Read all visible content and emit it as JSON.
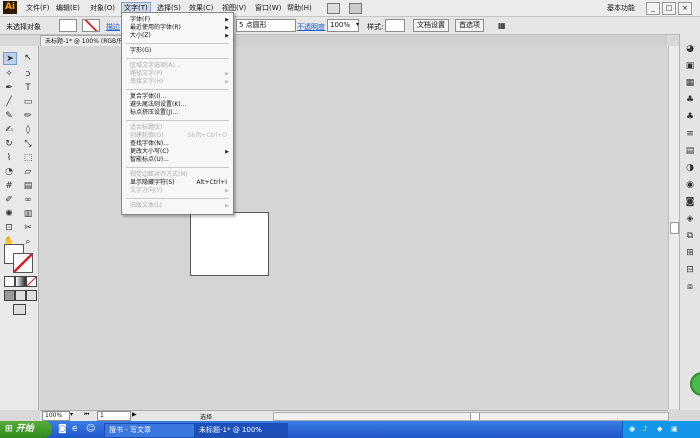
{
  "app": {
    "logo": "Ai",
    "workspace": "基本功能",
    "window_controls": [
      "_",
      "□",
      "×"
    ]
  },
  "menubar": {
    "items": [
      "文件(F)",
      "编辑(E)",
      "对象(O)",
      "文字(T)",
      "选择(S)",
      "效果(C)",
      "视图(V)",
      "窗口(W)",
      "帮助(H)"
    ]
  },
  "control_bar": {
    "selection": "未选择对象",
    "stroke_label": "描边",
    "brush": "5 点圆形",
    "opacity_label": "不透明度",
    "opacity_value": "100%",
    "style_label": "样式:",
    "doc_settings": "文档设置",
    "preferences": "首选项"
  },
  "document": {
    "tab_title": "未标题-1* @ 100% (RGB/预览)"
  },
  "type_menu": {
    "groups": [
      [
        {
          "label": "字体(F)",
          "enabled": true,
          "submenu": true
        },
        {
          "label": "最近使用的字体(R)",
          "enabled": true,
          "submenu": true
        },
        {
          "label": "大小(Z)",
          "enabled": true,
          "submenu": true
        }
      ],
      [
        {
          "label": "字形(G)",
          "enabled": true
        }
      ],
      [
        {
          "label": "区域文字选项(A)...",
          "enabled": false
        },
        {
          "label": "路径文字(P)",
          "enabled": false,
          "submenu": true
        },
        {
          "label": "串接文字(H)",
          "enabled": false,
          "submenu": true
        }
      ],
      [
        {
          "label": "复合字体(I)...",
          "enabled": true
        },
        {
          "label": "避头尾法则设置(K)...",
          "enabled": true
        },
        {
          "label": "标点挤压设置(J)...",
          "enabled": true
        }
      ],
      [
        {
          "label": "适合标题(E)",
          "enabled": false
        },
        {
          "label": "创建轮廓(O)",
          "enabled": false,
          "shortcut": "Shift+Ctrl+O"
        },
        {
          "label": "查找字体(N)...",
          "enabled": true
        },
        {
          "label": "更改大小写(C)",
          "enabled": true,
          "submenu": true
        },
        {
          "label": "智能标点(U)...",
          "enabled": true
        }
      ],
      [
        {
          "label": "视觉边距对齐方式(M)",
          "enabled": false
        },
        {
          "label": "显示隐藏字符(S)",
          "enabled": true,
          "shortcut": "Alt+Ctrl+I"
        },
        {
          "label": "文字方向(Y)",
          "enabled": false,
          "submenu": true
        }
      ],
      [
        {
          "label": "旧版文本(L)",
          "enabled": false,
          "submenu": true
        }
      ]
    ]
  },
  "status_bar": {
    "zoom": "100%",
    "page": "1",
    "tool": "选择"
  },
  "taskbar": {
    "start": "开始",
    "tasks": [
      "搜书 - 写文章",
      "未标题-1* @ 100%"
    ]
  },
  "colors": {
    "accent": "#1d5fcf",
    "taskbar": "#245edb",
    "start": "#3a9a2a"
  }
}
